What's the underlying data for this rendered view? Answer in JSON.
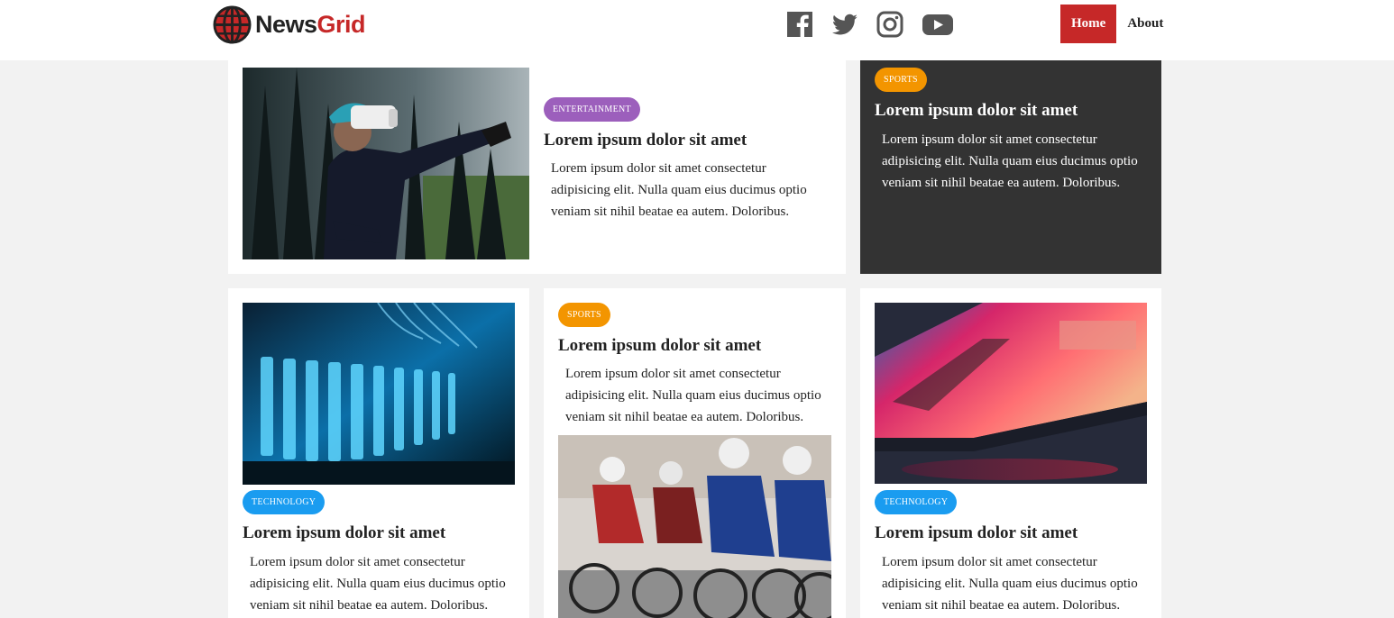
{
  "header": {
    "brand_part1": "News",
    "brand_part2": "Grid",
    "social": [
      "facebook-icon",
      "twitter-icon",
      "instagram-icon",
      "youtube-icon"
    ],
    "nav": [
      {
        "label": "Home",
        "active": true
      },
      {
        "label": "About",
        "active": false
      }
    ]
  },
  "colors": {
    "accent": "#c62828",
    "entertainment": "#9c5fbc",
    "sports": "#f39500",
    "technology": "#1a9cf0",
    "dark_card": "#333333"
  },
  "articles": [
    {
      "category": "ENTERTAINMENT",
      "title": "Lorem ipsum dolor sit amet",
      "excerpt": "Lorem ipsum dolor sit amet consectetur adipisicing elit. Nulla quam eius ducimus optio veniam sit nihil beatae ea autem. Doloribus.",
      "image": "vr-headset-photo"
    },
    {
      "category": "SPORTS",
      "title": "Lorem ipsum dolor sit amet",
      "excerpt": "Lorem ipsum dolor sit amet consectetur adipisicing elit. Nulla quam eius ducimus optio veniam sit nihil beatae ea autem. Doloribus."
    },
    {
      "category": "TECHNOLOGY",
      "title": "Lorem ipsum dolor sit amet",
      "excerpt": "Lorem ipsum dolor sit amet consectetur adipisicing elit. Nulla quam eius ducimus optio veniam sit nihil beatae ea autem. Doloribus.",
      "image": "server-rack-photo"
    },
    {
      "category": "SPORTS",
      "title": "Lorem ipsum dolor sit amet",
      "excerpt": "Lorem ipsum dolor sit amet consectetur adipisicing elit. Nulla quam eius ducimus optio veniam sit nihil beatae ea autem. Doloribus.",
      "image": "cyclists-photo"
    },
    {
      "category": "TECHNOLOGY",
      "title": "Lorem ipsum dolor sit amet",
      "excerpt": "Lorem ipsum dolor sit amet consectetur adipisicing elit. Nulla quam eius ducimus optio veniam sit nihil beatae ea autem. Doloribus.",
      "image": "laptop-photo"
    }
  ]
}
